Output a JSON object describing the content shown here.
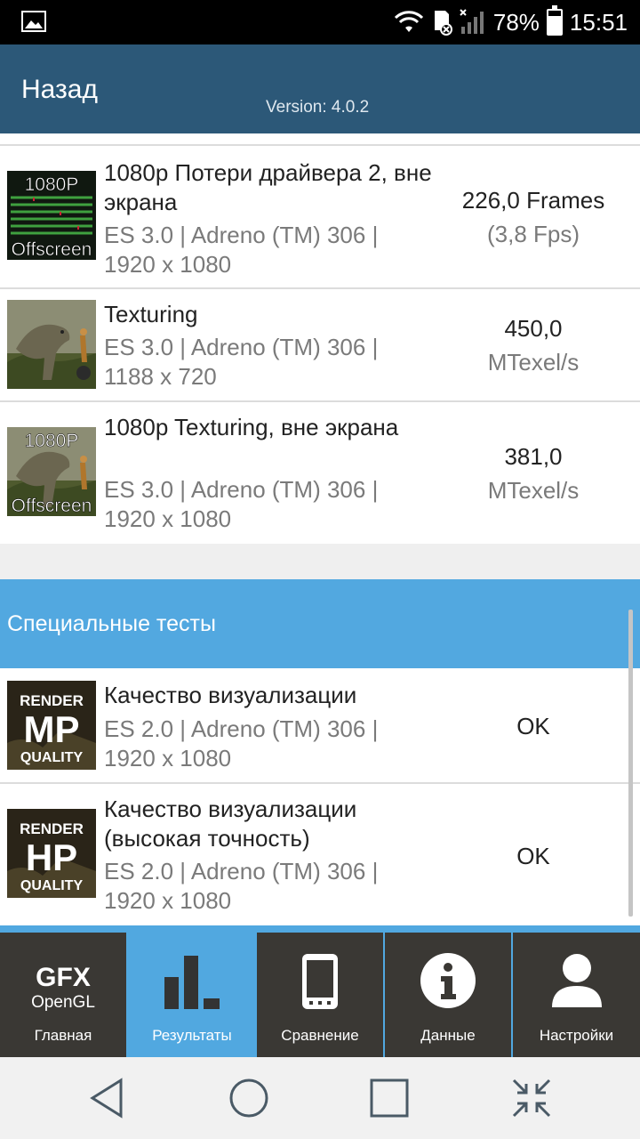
{
  "status_bar": {
    "battery": "78%",
    "battery_level": 0.78,
    "time": "15:51"
  },
  "header": {
    "back_label": "Назад",
    "version": "Version: 4.0.2"
  },
  "results": [
    {
      "title": "1080p Потери драйвера 2, вне экрана",
      "details_line1": "ES 3.0 | Adreno (TM) 306 |",
      "details_line2": "1920 x 1080",
      "value": "226,0 Frames",
      "unit": "(3,8 Fps)",
      "thumb_badge_top": "1080P",
      "thumb_badge_bottom": "Offscreen"
    },
    {
      "title": "Texturing",
      "details_line1": "ES 3.0 | Adreno (TM) 306 |",
      "details_line2": "1188 x 720",
      "value": "450,0",
      "unit": "MTexel/s"
    },
    {
      "title": "1080p Texturing, вне экрана",
      "details_line1": "ES 3.0 | Adreno (TM) 306 |",
      "details_line2": "1920 x 1080",
      "value": "381,0",
      "unit": "MTexel/s",
      "thumb_badge_top": "1080P",
      "thumb_badge_bottom": "Offscreen"
    }
  ],
  "special_section": {
    "title": "Специальные тесты"
  },
  "special_results": [
    {
      "title": "Качество визуализации",
      "details_line1": "ES 2.0 | Adreno (TM) 306 |",
      "details_line2": "1920 x 1080",
      "value": "OK",
      "thumb_top": "RENDER",
      "thumb_big": "MP",
      "thumb_bottom": "QUALITY"
    },
    {
      "title": "Качество визуализации (высокая точность)",
      "details_line1": "ES 2.0 | Adreno (TM) 306 |",
      "details_line2": "1920 x 1080",
      "value": "OK",
      "thumb_top": "RENDER",
      "thumb_big": "HP",
      "thumb_bottom": "QUALITY"
    }
  ],
  "tabs": [
    {
      "label": "Главная",
      "logo_line1": "GFX",
      "logo_line2": "OpenGL",
      "icon": "gfx-logo-icon"
    },
    {
      "label": "Результаты",
      "icon": "bar-chart-icon",
      "active": true
    },
    {
      "label": "Сравнение",
      "icon": "phone-icon"
    },
    {
      "label": "Данные",
      "icon": "info-icon"
    },
    {
      "label": "Настройки",
      "icon": "user-icon"
    }
  ],
  "system_nav": [
    "back-icon",
    "home-icon",
    "recents-icon",
    "collapse-icon"
  ],
  "colors": {
    "header": "#2c5878",
    "accent": "#52a8e0",
    "tab_bg": "#3a3834"
  }
}
